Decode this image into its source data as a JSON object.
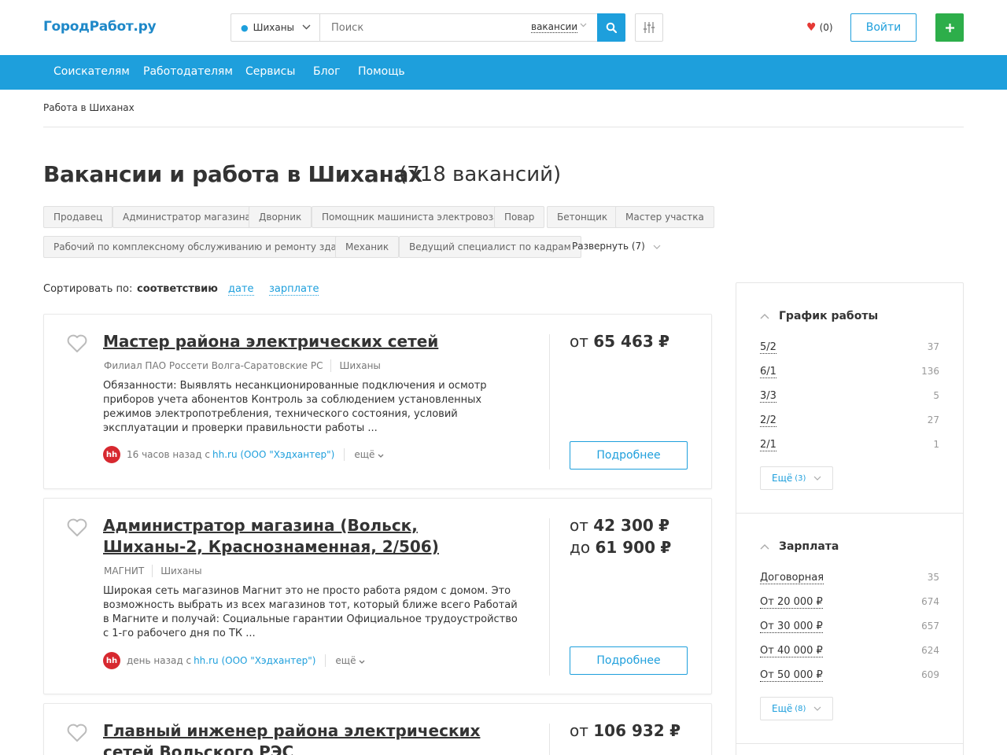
{
  "header": {
    "logo": "ГородРабот.ру",
    "city": "Шиханы",
    "search_placeholder": "Поиск",
    "search_type": "вакансии",
    "favorites_count": "(0)",
    "login_label": "Войти",
    "add_label": "+"
  },
  "nav": {
    "items": [
      "Соискателям",
      "Работодателям",
      "Сервисы",
      "Блог",
      "Помощь"
    ]
  },
  "breadcrumb": "Работа в Шиханах",
  "page": {
    "title": "Вакансии и работа в Шиханах",
    "count": "(718 вакансий)"
  },
  "tags": [
    "Продавец",
    "Администратор магазина",
    "Дворник",
    "Помощник машиниста электровоза",
    "Повар",
    "Бетонщик",
    "Мастер участка",
    "Рабочий по комплексному обслуживанию и ремонту зданий",
    "Механик",
    "Ведущий специалист по кадрам"
  ],
  "expand_label": "Развернуть (7)",
  "sort": {
    "label": "Сортировать по:",
    "active": "соответствию",
    "options": [
      "дате",
      "зарплате"
    ]
  },
  "vacancies": [
    {
      "title": "Мастер района электрических сетей",
      "company": "Филиал ПАО Россети Волга-Саратовские РС",
      "city": "Шиханы",
      "description": "Обязанности: Выявлять несанкционированные подключения и осмотр приборов учета абонентов Контроль за соблюдением установленных режимов электропотребления, технического состояния, условий эксплуатации и проверки правильности работы ...",
      "time": "16 часов назад с",
      "source": "hh.ru (ООО \"Хэдхантер\")",
      "more": "ещё",
      "salary_from": "65 463",
      "salary_prefix": "от",
      "currency": "₽",
      "details_label": "Подробнее"
    },
    {
      "title": "Администратор магазина (Вольск, Шиханы-2, Краснознаменная, 2/506)",
      "company": "МАГНИТ",
      "city": "Шиханы",
      "description": "Широкая сеть магазинов Магнит это не просто работа рядом с домом. Это возможность выбрать из всех магазинов тот, который ближе всего Работай в Магните и получай: Социальные гарантии Официальное трудоустройство с 1-го рабочего дня по ТК ...",
      "time": "день назад с",
      "source": "hh.ru (ООО \"Хэдхантер\")",
      "more": "ещё",
      "salary_from": "42 300",
      "salary_to": "61 900",
      "salary_prefix": "от",
      "salary_to_prefix": "до",
      "currency": "₽",
      "details_label": "Подробнее"
    },
    {
      "title": "Главный инженер района электрических сетей Вольского РЭС",
      "salary_from": "106 932",
      "salary_prefix": "от",
      "currency": "₽"
    }
  ],
  "sidebar": {
    "schedule": {
      "title": "График работы",
      "rows": [
        {
          "label": "5/2",
          "count": "37"
        },
        {
          "label": "6/1",
          "count": "136"
        },
        {
          "label": "3/3",
          "count": "5"
        },
        {
          "label": "2/2",
          "count": "27"
        },
        {
          "label": "2/1",
          "count": "1"
        }
      ],
      "more": "Ещё",
      "more_count": "(3)"
    },
    "salary": {
      "title": "Зарплата",
      "rows": [
        {
          "label": "Договорная",
          "count": "35"
        },
        {
          "label": "От 20 000 ₽",
          "count": "674"
        },
        {
          "label": "От 30 000 ₽",
          "count": "657"
        },
        {
          "label": "От 40 000 ₽",
          "count": "624"
        },
        {
          "label": "От 50 000 ₽",
          "count": "609"
        }
      ],
      "more": "Ещё",
      "more_count": "(8)"
    }
  },
  "colors": {
    "primary": "#1e9fdc",
    "brand": "#1e88c8",
    "add_button": "#2dae4a",
    "heart": "#e53935",
    "hh_logo": "#d7282f"
  }
}
